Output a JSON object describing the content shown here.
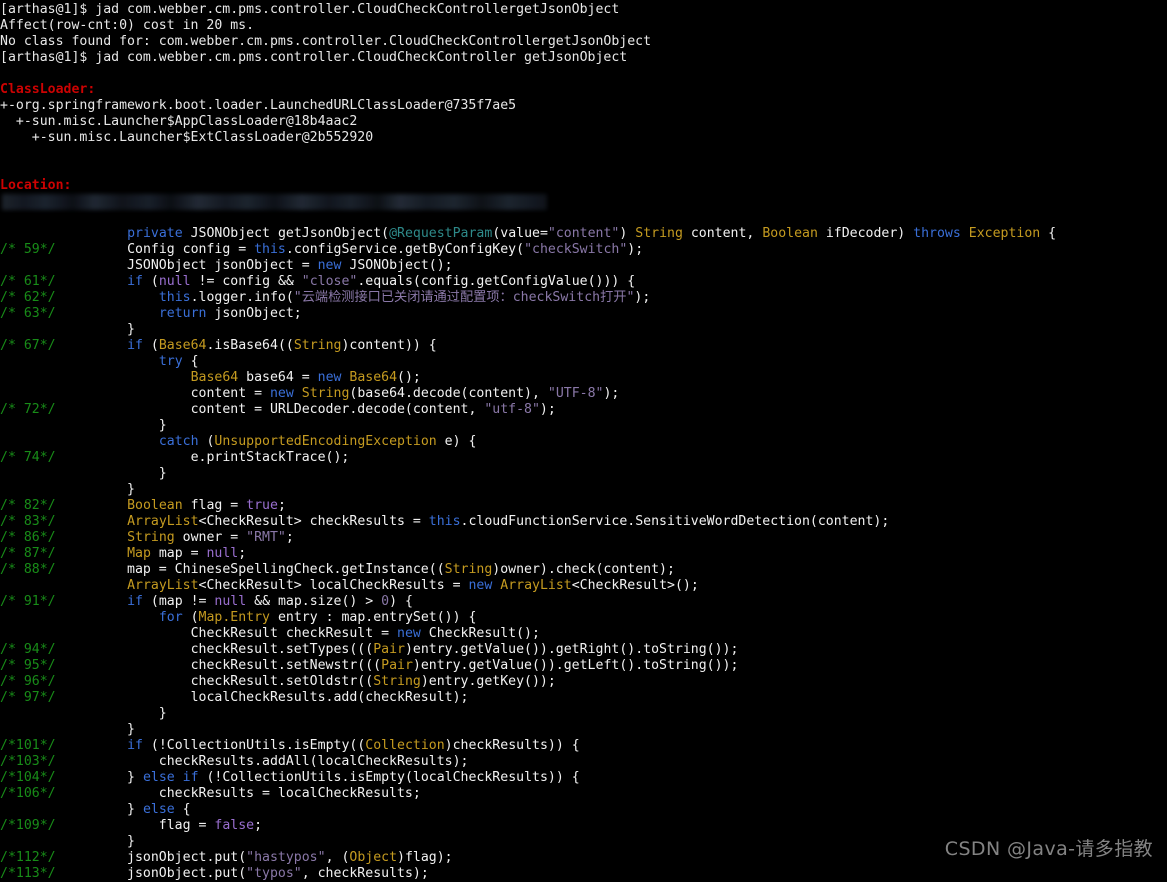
{
  "terminal": {
    "prompt": "[arthas@1]$",
    "background_color": "#000000",
    "foreground_color": "#e8e8e8",
    "header_color": "#cc0202",
    "comment_color": "#188c18",
    "keyword_color": "#3a6fd8",
    "type_color": "#c59b20",
    "string_color": "#8a78a8"
  },
  "session": {
    "cmd1": "[arthas@1]$ jad com.webber.cm.pms.controller.CloudCheckControllergetJsonObject",
    "affect": "Affect(row-cnt:0) cost in 20 ms.",
    "error": "No class found for: com.webber.cm.pms.controller.CloudCheckControllergetJsonObject",
    "cmd2": "[arthas@1]$ jad com.webber.cm.pms.controller.CloudCheckController getJsonObject"
  },
  "classloader": {
    "header": "ClassLoader:",
    "entries": [
      "+-org.springframework.boot.loader.LaunchedURLClassLoader@735f7ae5",
      "  +-sun.misc.Launcher$AppClassLoader@18b4aac2",
      "    +-sun.misc.Launcher$ExtClassLoader@2b552920"
    ]
  },
  "location": {
    "header": "Location:",
    "path_redacted": true
  },
  "code": {
    "signature": {
      "line_no": "",
      "tokens": [
        {
          "t": "        ",
          "c": "plain"
        },
        {
          "t": "private",
          "c": "keyword"
        },
        {
          "t": " ",
          "c": "plain"
        },
        {
          "t": "JSONObject",
          "c": "white"
        },
        {
          "t": " getJsonObject(",
          "c": "white"
        },
        {
          "t": "@RequestParam",
          "c": "annot"
        },
        {
          "t": "(",
          "c": "white"
        },
        {
          "t": "value=",
          "c": "white"
        },
        {
          "t": "\"content\"",
          "c": "string"
        },
        {
          "t": ") ",
          "c": "white"
        },
        {
          "t": "String",
          "c": "type"
        },
        {
          "t": " content, ",
          "c": "white"
        },
        {
          "t": "Boolean",
          "c": "type"
        },
        {
          "t": " ifDecoder) ",
          "c": "white"
        },
        {
          "t": "throws",
          "c": "keyword"
        },
        {
          "t": " ",
          "c": "plain"
        },
        {
          "t": "Exception",
          "c": "type"
        },
        {
          "t": " {",
          "c": "white"
        }
      ]
    },
    "lines": [
      {
        "no": "/* 59*/",
        "tokens": [
          {
            "t": "        ",
            "c": "plain"
          },
          {
            "t": "Config",
            "c": "white"
          },
          {
            "t": " config = ",
            "c": "white"
          },
          {
            "t": "this",
            "c": "keyword"
          },
          {
            "t": ".configService.getByConfigKey(",
            "c": "white"
          },
          {
            "t": "\"checkSwitch\"",
            "c": "string"
          },
          {
            "t": ");",
            "c": "white"
          }
        ]
      },
      {
        "no": "",
        "tokens": [
          {
            "t": "        JSONObject jsonObject = ",
            "c": "white"
          },
          {
            "t": "new",
            "c": "keyword"
          },
          {
            "t": " JSONObject();",
            "c": "white"
          }
        ]
      },
      {
        "no": "/* 61*/",
        "tokens": [
          {
            "t": "        ",
            "c": "plain"
          },
          {
            "t": "if",
            "c": "keyword"
          },
          {
            "t": " (",
            "c": "white"
          },
          {
            "t": "null",
            "c": "literal"
          },
          {
            "t": " != config && ",
            "c": "white"
          },
          {
            "t": "\"close\"",
            "c": "string"
          },
          {
            "t": ".equals(config.getConfigValue())) {",
            "c": "white"
          }
        ]
      },
      {
        "no": "/* 62*/",
        "tokens": [
          {
            "t": "            ",
            "c": "plain"
          },
          {
            "t": "this",
            "c": "keyword"
          },
          {
            "t": ".logger.info(",
            "c": "white"
          },
          {
            "t": "\"云端检测接口已关闭请通过配置项：checkSwitch打开\"",
            "c": "string"
          },
          {
            "t": ");",
            "c": "white"
          }
        ]
      },
      {
        "no": "/* 63*/",
        "tokens": [
          {
            "t": "            ",
            "c": "plain"
          },
          {
            "t": "return",
            "c": "keyword"
          },
          {
            "t": " jsonObject;",
            "c": "white"
          }
        ]
      },
      {
        "no": "",
        "tokens": [
          {
            "t": "        }",
            "c": "white"
          }
        ]
      },
      {
        "no": "/* 67*/",
        "tokens": [
          {
            "t": "        ",
            "c": "plain"
          },
          {
            "t": "if",
            "c": "keyword"
          },
          {
            "t": " (",
            "c": "white"
          },
          {
            "t": "Base64",
            "c": "type"
          },
          {
            "t": ".isBase64((",
            "c": "white"
          },
          {
            "t": "String",
            "c": "type"
          },
          {
            "t": ")content)) {",
            "c": "white"
          }
        ]
      },
      {
        "no": "",
        "tokens": [
          {
            "t": "            ",
            "c": "plain"
          },
          {
            "t": "try",
            "c": "keyword"
          },
          {
            "t": " {",
            "c": "white"
          }
        ]
      },
      {
        "no": "",
        "tokens": [
          {
            "t": "                ",
            "c": "plain"
          },
          {
            "t": "Base64",
            "c": "type"
          },
          {
            "t": " base64 = ",
            "c": "white"
          },
          {
            "t": "new",
            "c": "keyword"
          },
          {
            "t": " ",
            "c": "plain"
          },
          {
            "t": "Base64",
            "c": "type"
          },
          {
            "t": "();",
            "c": "white"
          }
        ]
      },
      {
        "no": "",
        "tokens": [
          {
            "t": "                content = ",
            "c": "white"
          },
          {
            "t": "new",
            "c": "keyword"
          },
          {
            "t": " ",
            "c": "plain"
          },
          {
            "t": "String",
            "c": "type"
          },
          {
            "t": "(base64.decode(content), ",
            "c": "white"
          },
          {
            "t": "\"UTF-8\"",
            "c": "string"
          },
          {
            "t": ");",
            "c": "white"
          }
        ]
      },
      {
        "no": "/* 72*/",
        "tokens": [
          {
            "t": "                content = URLDecoder.decode(content, ",
            "c": "white"
          },
          {
            "t": "\"utf-8\"",
            "c": "string"
          },
          {
            "t": ");",
            "c": "white"
          }
        ]
      },
      {
        "no": "",
        "tokens": [
          {
            "t": "            }",
            "c": "white"
          }
        ]
      },
      {
        "no": "",
        "tokens": [
          {
            "t": "            ",
            "c": "plain"
          },
          {
            "t": "catch",
            "c": "keyword"
          },
          {
            "t": " (",
            "c": "white"
          },
          {
            "t": "UnsupportedEncodingException",
            "c": "type"
          },
          {
            "t": " e) {",
            "c": "white"
          }
        ]
      },
      {
        "no": "/* 74*/",
        "tokens": [
          {
            "t": "                e.printStackTrace();",
            "c": "white"
          }
        ]
      },
      {
        "no": "",
        "tokens": [
          {
            "t": "            }",
            "c": "white"
          }
        ]
      },
      {
        "no": "",
        "tokens": [
          {
            "t": "        }",
            "c": "white"
          }
        ]
      },
      {
        "no": "/* 82*/",
        "tokens": [
          {
            "t": "        ",
            "c": "plain"
          },
          {
            "t": "Boolean",
            "c": "type"
          },
          {
            "t": " flag = ",
            "c": "white"
          },
          {
            "t": "true",
            "c": "literal"
          },
          {
            "t": ";",
            "c": "white"
          }
        ]
      },
      {
        "no": "/* 83*/",
        "tokens": [
          {
            "t": "        ",
            "c": "plain"
          },
          {
            "t": "ArrayList",
            "c": "type"
          },
          {
            "t": "<CheckResult> checkResults = ",
            "c": "white"
          },
          {
            "t": "this",
            "c": "keyword"
          },
          {
            "t": ".cloudFunctionService.SensitiveWordDetection(content);",
            "c": "white"
          }
        ]
      },
      {
        "no": "/* 86*/",
        "tokens": [
          {
            "t": "        ",
            "c": "plain"
          },
          {
            "t": "String",
            "c": "type"
          },
          {
            "t": " owner = ",
            "c": "white"
          },
          {
            "t": "\"RMT\"",
            "c": "string"
          },
          {
            "t": ";",
            "c": "white"
          }
        ]
      },
      {
        "no": "/* 87*/",
        "tokens": [
          {
            "t": "        ",
            "c": "plain"
          },
          {
            "t": "Map",
            "c": "type"
          },
          {
            "t": " map = ",
            "c": "white"
          },
          {
            "t": "null",
            "c": "literal"
          },
          {
            "t": ";",
            "c": "white"
          }
        ]
      },
      {
        "no": "/* 88*/",
        "tokens": [
          {
            "t": "        map = ChineseSpellingCheck.getInstance((",
            "c": "white"
          },
          {
            "t": "String",
            "c": "type"
          },
          {
            "t": ")owner).check(content);",
            "c": "white"
          }
        ]
      },
      {
        "no": "",
        "tokens": [
          {
            "t": "        ",
            "c": "plain"
          },
          {
            "t": "ArrayList",
            "c": "type"
          },
          {
            "t": "<CheckResult> localCheckResults = ",
            "c": "white"
          },
          {
            "t": "new",
            "c": "keyword"
          },
          {
            "t": " ",
            "c": "plain"
          },
          {
            "t": "ArrayList",
            "c": "type"
          },
          {
            "t": "<CheckResult>();",
            "c": "white"
          }
        ]
      },
      {
        "no": "/* 91*/",
        "tokens": [
          {
            "t": "        ",
            "c": "plain"
          },
          {
            "t": "if",
            "c": "keyword"
          },
          {
            "t": " (map != ",
            "c": "white"
          },
          {
            "t": "null",
            "c": "literal"
          },
          {
            "t": " && map.size() > ",
            "c": "white"
          },
          {
            "t": "0",
            "c": "num"
          },
          {
            "t": ") {",
            "c": "white"
          }
        ]
      },
      {
        "no": "",
        "tokens": [
          {
            "t": "            ",
            "c": "plain"
          },
          {
            "t": "for",
            "c": "keyword"
          },
          {
            "t": " (",
            "c": "white"
          },
          {
            "t": "Map.Entry",
            "c": "type"
          },
          {
            "t": " entry : map.entrySet()) {",
            "c": "white"
          }
        ]
      },
      {
        "no": "",
        "tokens": [
          {
            "t": "                CheckResult checkResult = ",
            "c": "white"
          },
          {
            "t": "new",
            "c": "keyword"
          },
          {
            "t": " CheckResult();",
            "c": "white"
          }
        ]
      },
      {
        "no": "/* 94*/",
        "tokens": [
          {
            "t": "                checkResult.setTypes(((",
            "c": "white"
          },
          {
            "t": "Pair",
            "c": "type"
          },
          {
            "t": ")entry.getValue()).getRight().toString());",
            "c": "white"
          }
        ]
      },
      {
        "no": "/* 95*/",
        "tokens": [
          {
            "t": "                checkResult.setNewstr(((",
            "c": "white"
          },
          {
            "t": "Pair",
            "c": "type"
          },
          {
            "t": ")entry.getValue()).getLeft().toString());",
            "c": "white"
          }
        ]
      },
      {
        "no": "/* 96*/",
        "tokens": [
          {
            "t": "                checkResult.setOldstr((",
            "c": "white"
          },
          {
            "t": "String",
            "c": "type"
          },
          {
            "t": ")entry.getKey());",
            "c": "white"
          }
        ]
      },
      {
        "no": "/* 97*/",
        "tokens": [
          {
            "t": "                localCheckResults.add(checkResult);",
            "c": "white"
          }
        ]
      },
      {
        "no": "",
        "tokens": [
          {
            "t": "            }",
            "c": "white"
          }
        ]
      },
      {
        "no": "",
        "tokens": [
          {
            "t": "        }",
            "c": "white"
          }
        ]
      },
      {
        "no": "/*101*/",
        "tokens": [
          {
            "t": "        ",
            "c": "plain"
          },
          {
            "t": "if",
            "c": "keyword"
          },
          {
            "t": " (!CollectionUtils.isEmpty((",
            "c": "white"
          },
          {
            "t": "Collection",
            "c": "type"
          },
          {
            "t": ")checkResults)) {",
            "c": "white"
          }
        ]
      },
      {
        "no": "/*103*/",
        "tokens": [
          {
            "t": "            checkResults.addAll(localCheckResults);",
            "c": "white"
          }
        ]
      },
      {
        "no": "/*104*/",
        "tokens": [
          {
            "t": "        } ",
            "c": "white"
          },
          {
            "t": "else",
            "c": "keyword"
          },
          {
            "t": " ",
            "c": "plain"
          },
          {
            "t": "if",
            "c": "keyword"
          },
          {
            "t": " (!CollectionUtils.isEmpty(localCheckResults)) {",
            "c": "white"
          }
        ]
      },
      {
        "no": "/*106*/",
        "tokens": [
          {
            "t": "            checkResults = localCheckResults;",
            "c": "white"
          }
        ]
      },
      {
        "no": "",
        "tokens": [
          {
            "t": "        } ",
            "c": "white"
          },
          {
            "t": "else",
            "c": "keyword"
          },
          {
            "t": " {",
            "c": "white"
          }
        ]
      },
      {
        "no": "/*109*/",
        "tokens": [
          {
            "t": "            flag = ",
            "c": "white"
          },
          {
            "t": "false",
            "c": "literal"
          },
          {
            "t": ";",
            "c": "white"
          }
        ]
      },
      {
        "no": "",
        "tokens": [
          {
            "t": "        }",
            "c": "white"
          }
        ]
      },
      {
        "no": "/*112*/",
        "tokens": [
          {
            "t": "        jsonObject.put(",
            "c": "white"
          },
          {
            "t": "\"hastypos\"",
            "c": "string"
          },
          {
            "t": ", (",
            "c": "white"
          },
          {
            "t": "Object",
            "c": "type"
          },
          {
            "t": ")flag);",
            "c": "white"
          }
        ]
      },
      {
        "no": "/*113*/",
        "tokens": [
          {
            "t": "        jsonObject.put(",
            "c": "white"
          },
          {
            "t": "\"typos\"",
            "c": "string"
          },
          {
            "t": ", checkResults);",
            "c": "white"
          }
        ]
      }
    ]
  },
  "watermark": {
    "text": "CSDN @Java-请多指教"
  }
}
